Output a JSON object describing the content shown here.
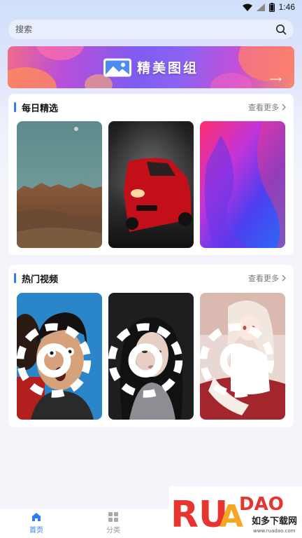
{
  "status_bar": {
    "time": "1:46"
  },
  "search": {
    "placeholder": "搜索"
  },
  "banner": {
    "title": "精美图组"
  },
  "daily": {
    "title": "每日精选",
    "more_label": "查看更多",
    "items": [
      "desert-mountain-photo",
      "red-sports-car-photo",
      "abstract-gradient-photo"
    ]
  },
  "videos": {
    "title": "热门视频",
    "more_label": "查看更多",
    "items": [
      "surprised-man-photo",
      "woman-portrait-photo",
      "anime-girl-photo"
    ]
  },
  "tab_bar": {
    "tabs": [
      {
        "label": "首页",
        "icon": "home-icon",
        "active": true
      },
      {
        "label": "分类",
        "icon": "grid-icon",
        "active": false
      }
    ]
  },
  "watermark": {
    "brand": "RUANDAO",
    "chinese": "如多下载网",
    "url": "www.ruadao.com"
  },
  "colors": {
    "accent": "#2f7df6",
    "active_tab": "#2f7df6",
    "inactive_tab": "#999999"
  }
}
